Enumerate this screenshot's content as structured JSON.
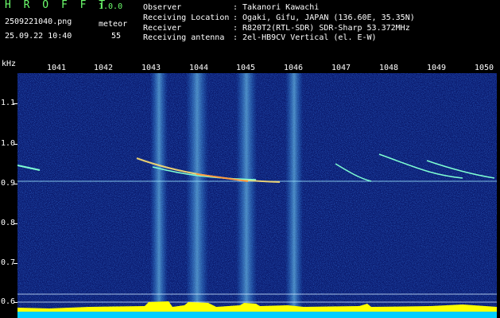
{
  "header": {
    "app_name": "H R O F F T",
    "version": "1.0.0",
    "filename": "2509221040.png",
    "meteor_label": "meteor",
    "datetime": "25.09.22 10:40",
    "meteor_count": "55",
    "info": [
      {
        "key": "Observer",
        "value": "Takanori Kawachi"
      },
      {
        "key": "Receiving Location",
        "value": "Ogaki, Gifu, JAPAN (136.60E, 35.35N)"
      },
      {
        "key": "Receiver",
        "value": "R820T2(RTL-SDR) SDR-Sharp 53.372MHz"
      },
      {
        "key": "Receiving antenna",
        "value": "2el-HB9CV Vertical (el. E-W)"
      }
    ]
  },
  "axis": {
    "y_unit": "kHz",
    "x_ticks": [
      "1041",
      "1042",
      "1043",
      "1044",
      "1045",
      "1046",
      "1047",
      "1048",
      "1049",
      "1050"
    ],
    "y_ticks": [
      "1.1",
      "1.0",
      "0.9",
      "0.8",
      "0.7",
      "0.6"
    ]
  },
  "colors": {
    "background": "#000000",
    "spectrogram_bg": "#0a1a6e",
    "header_accent": "#6dff6d",
    "intensity_bar": "#ffff00",
    "floor_bar": "#00cfff"
  }
}
